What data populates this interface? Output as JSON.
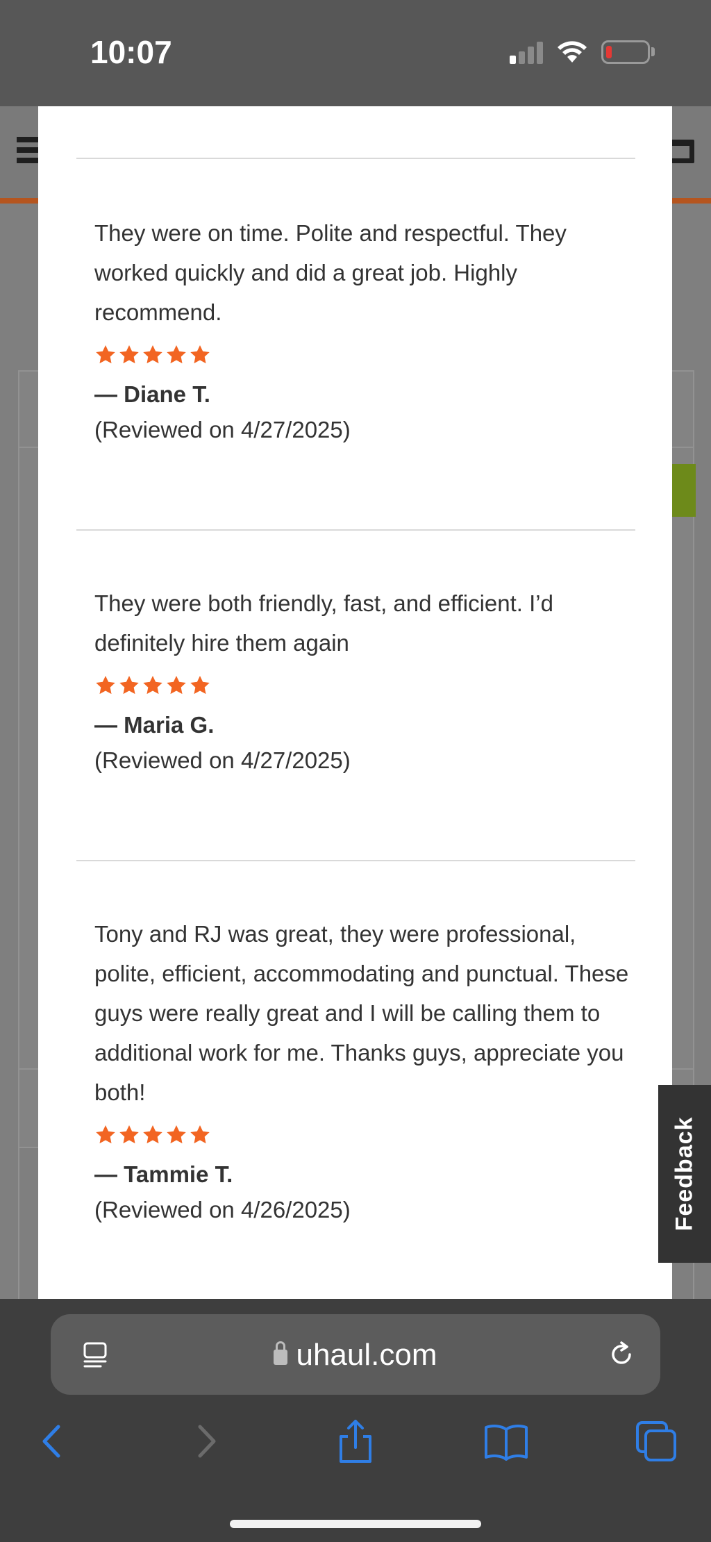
{
  "status_bar": {
    "time": "10:07"
  },
  "reviews": [
    {
      "text": "They were on time. Polite and respectful. They worked quickly and did a great job. Highly recommend.",
      "rating": 5,
      "reviewer": "— Diane T.",
      "date": "(Reviewed on 4/27/2025)"
    },
    {
      "text": "They were both friendly, fast, and efficient. I’d definitely hire them again",
      "rating": 5,
      "reviewer": "— Maria G.",
      "date": "(Reviewed on 4/27/2025)"
    },
    {
      "text": "Tony and RJ was great, they were professional, polite, efficient, accommodating and punctual. These guys were really great and I will be calling them to additional work for me. Thanks guys, appreciate you both!",
      "rating": 5,
      "reviewer": "— Tammie T.",
      "date": "(Reviewed on 4/26/2025)"
    }
  ],
  "feedback_tab": {
    "label": "Feedback"
  },
  "browser": {
    "url": "uhaul.com"
  },
  "colors": {
    "star": "#f26522",
    "accent_orange": "#b5551f",
    "ios_blue": "#2f7ee6"
  },
  "icons": [
    "signal-icon",
    "wifi-icon",
    "battery-icon",
    "star-icon",
    "tab-overview-icon",
    "lock-icon",
    "reload-icon",
    "back-icon",
    "forward-icon",
    "share-icon",
    "bookmarks-icon",
    "tabs-icon"
  ]
}
